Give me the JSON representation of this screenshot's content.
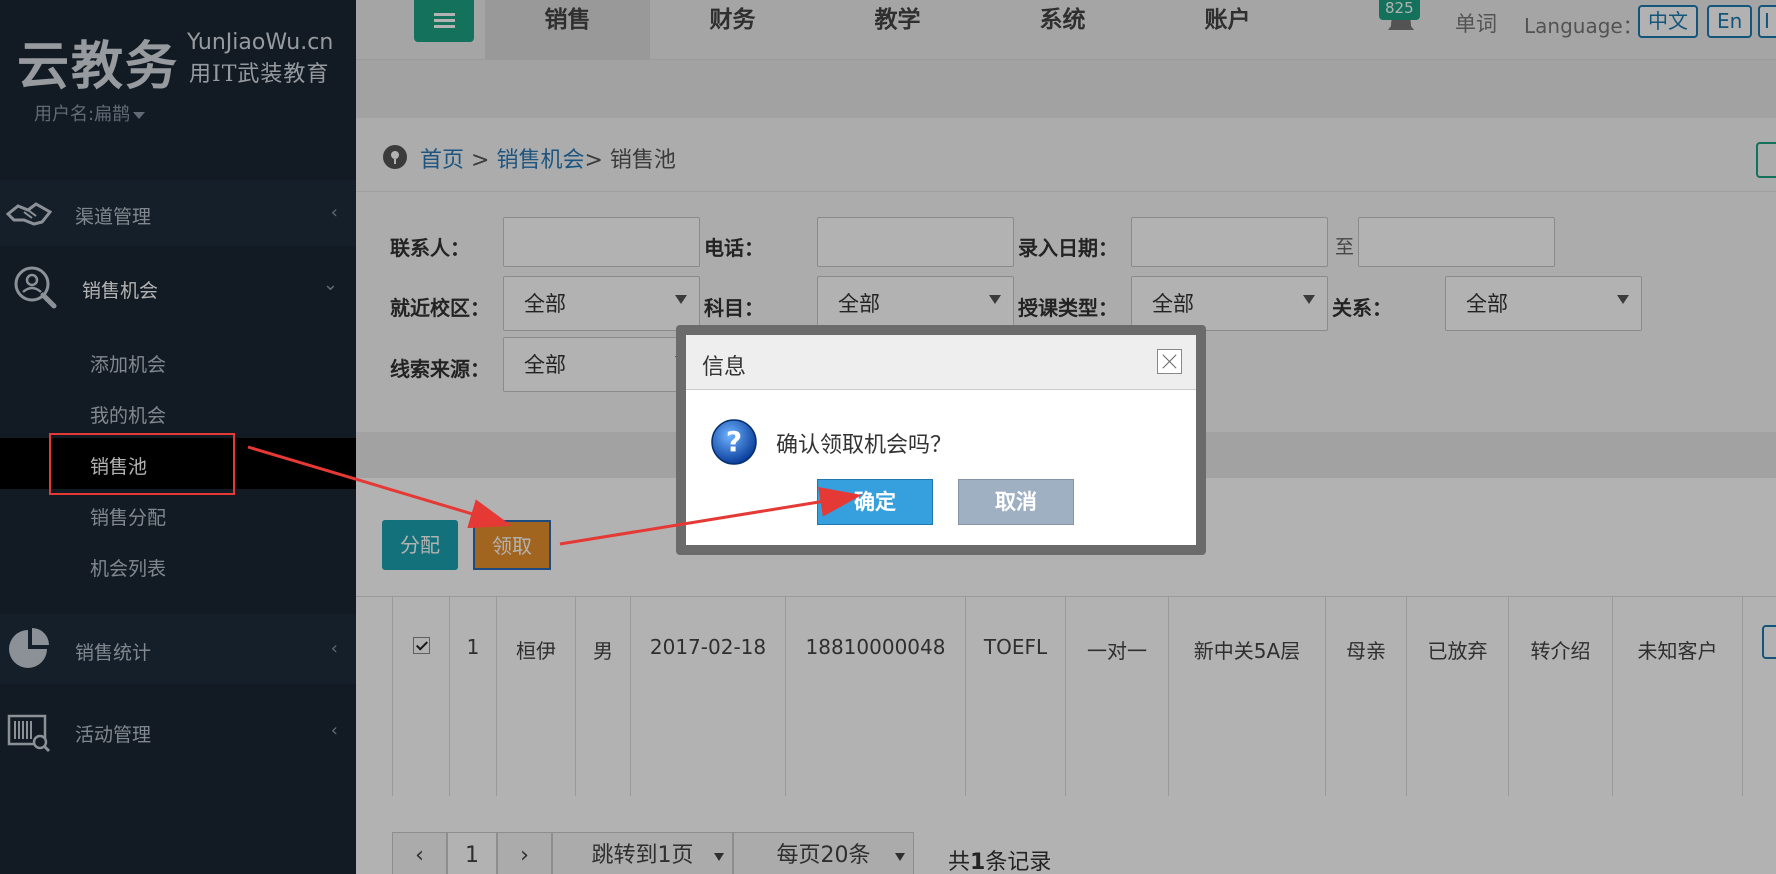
{
  "brand": {
    "logo_cn": "云教务",
    "logo_en": "YunJiaoWu.cn",
    "logo_sub": "用IT武装教育",
    "username": "用户名:扁鹊"
  },
  "sidebar": {
    "groups": [
      {
        "label": "渠道管理",
        "icon": "handshake-icon",
        "expanded": false
      },
      {
        "label": "销售机会",
        "icon": "user-search-icon",
        "expanded": true
      },
      {
        "label": "销售统计",
        "icon": "pie-chart-icon",
        "expanded": false
      },
      {
        "label": "活动管理",
        "icon": "barcode-search-icon",
        "expanded": false
      }
    ],
    "sub_items": [
      "添加机会",
      "我的机会",
      "销售池",
      "销售分配",
      "机会列表"
    ],
    "active_sub": "销售池"
  },
  "topnav": {
    "tabs": [
      "销售",
      "财务",
      "教学",
      "系统",
      "账户"
    ],
    "active_tab": "销售",
    "badge_count": "825",
    "word_link": "单词",
    "language_label": "Language：",
    "lang_options": [
      "中文",
      "En",
      "I"
    ]
  },
  "breadcrumb": {
    "home": "首页",
    "sep1": " > ",
    "parent": "销售机会",
    "sep2": "> ",
    "current": "销售池"
  },
  "filters": {
    "contact_label": "联系人：",
    "phone_label": "电话：",
    "entry_date_label": "录入日期：",
    "to_label": "至",
    "campus_label": "就近校区：",
    "campus_value": "全部",
    "subject_label": "科目：",
    "subject_value": "全部",
    "class_type_label": "授课类型：",
    "class_type_value": "全部",
    "relation_label": "关系：",
    "relation_value": "全部",
    "source_label": "线索来源：",
    "source_value": "全部"
  },
  "actions": {
    "assign_label": "分配",
    "claim_label": "领取"
  },
  "table": {
    "rows": [
      [
        "1",
        "桓伊",
        "男",
        "2017-02-18",
        "18810000048",
        "TOEFL",
        "一对一",
        "新中关5A层",
        "母亲",
        "已放弃",
        "转介绍",
        "未知客户"
      ]
    ]
  },
  "pager": {
    "prev": "‹",
    "page": "1",
    "next": "›",
    "jump": "跳转到1页",
    "per_page": "每页20条",
    "total_prefix": "共",
    "total_count": "1",
    "total_suffix": "条记录"
  },
  "dialog": {
    "title": "信息",
    "message": "确认领取机会吗？",
    "ok": "确定",
    "cancel": "取消"
  },
  "colors": {
    "sidebar_bg": "#1a2734",
    "accent_green": "#1ca385",
    "claim_orange": "#e8912f",
    "ok_blue": "#36a0df",
    "annotation_red": "#e53935"
  }
}
